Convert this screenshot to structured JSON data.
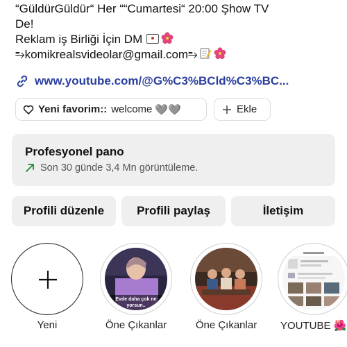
{
  "bio": {
    "line1": "“GüldürGüldür“ Her ““Cumartesi“ 20:00 Şhow TV",
    "line2": "De!",
    "line3": "Reklam iş Birliği İçin DM",
    "line4": "⥱komikrealsvideolar@gmail.com⥱"
  },
  "link": {
    "url": "www.youtube.com/@G%C3%BCld%C3%BC..."
  },
  "chips": {
    "favorite_label": "Yeni favorim::",
    "favorite_value": "welcome",
    "favorite_hearts": "🩶🩶",
    "add_label": "Ekle"
  },
  "dashboard": {
    "title": "Profesyonel pano",
    "subtitle": "Son 30 günde 3,4 Mn görüntüleme."
  },
  "actions": {
    "edit": "Profili düzenle",
    "share": "Profili paylaş",
    "contact": "İletişim"
  },
  "highlights": [
    {
      "label": "Yeni"
    },
    {
      "label": "Öne Çıkanlar",
      "overlay_text": "Evde daha çok ne yorsun.."
    },
    {
      "label": "Öne Çıkanlar"
    },
    {
      "label": "YOUTUBE 🌺"
    }
  ],
  "colors": {
    "link": "#2a3f9e",
    "panel_bg": "#efefef",
    "trend_green": "#1a8a3a",
    "flower": "#e0457b"
  },
  "icons": [
    "link-icon",
    "heart-icon",
    "plus-icon",
    "trend-arrow-icon",
    "envelope-icon",
    "flower-icon",
    "memo-icon"
  ]
}
